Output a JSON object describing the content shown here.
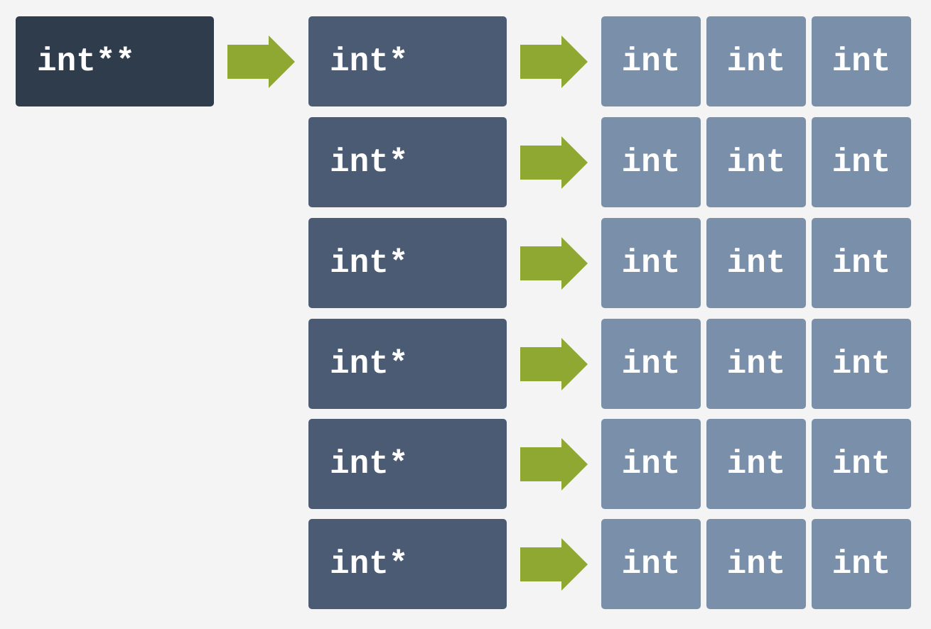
{
  "colors": {
    "double_pointer": "#2f3c4b",
    "pointer": "#4a5b73",
    "int_cell": "#7a8fa9",
    "arrow": "#8fa832",
    "background": "#f4f4f4"
  },
  "double_pointer": {
    "label": "int**"
  },
  "rows": [
    {
      "pointer": "int*",
      "cells": [
        "int",
        "int",
        "int"
      ]
    },
    {
      "pointer": "int*",
      "cells": [
        "int",
        "int",
        "int"
      ]
    },
    {
      "pointer": "int*",
      "cells": [
        "int",
        "int",
        "int"
      ]
    },
    {
      "pointer": "int*",
      "cells": [
        "int",
        "int",
        "int"
      ]
    },
    {
      "pointer": "int*",
      "cells": [
        "int",
        "int",
        "int"
      ]
    },
    {
      "pointer": "int*",
      "cells": [
        "int",
        "int",
        "int"
      ]
    }
  ]
}
